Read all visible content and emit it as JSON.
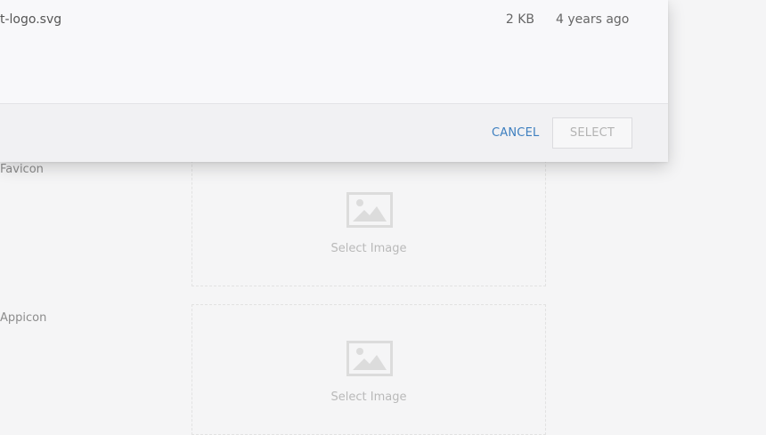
{
  "dialog": {
    "file": {
      "name": "t-logo.svg",
      "size": "2 KB",
      "modified": "4 years ago"
    },
    "footer": {
      "cancel_label": "CANCEL",
      "select_label": "SELECT"
    }
  },
  "settings": {
    "favicon": {
      "label": "Favicon",
      "placeholder": "Select Image",
      "icon": "image-placeholder-icon"
    },
    "appicon": {
      "label": "Appicon",
      "placeholder": "Select Image",
      "icon": "image-placeholder-icon"
    }
  }
}
